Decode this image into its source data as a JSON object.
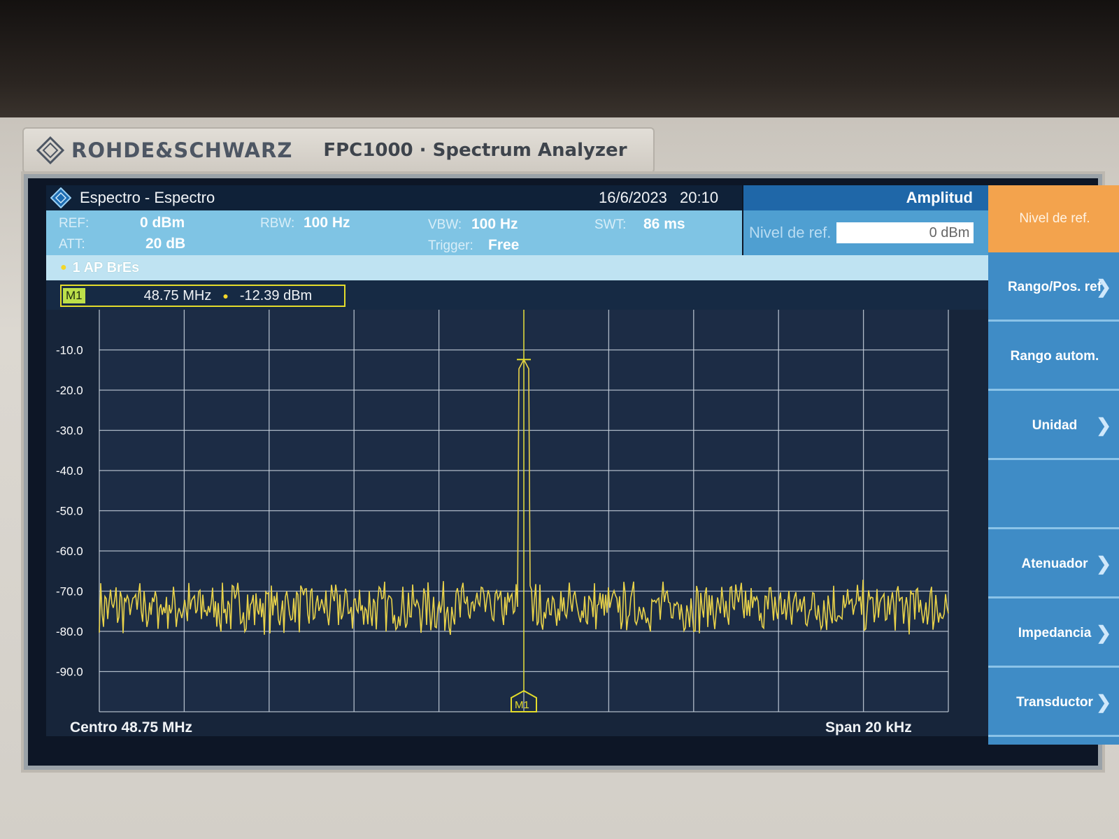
{
  "brand": {
    "name": "ROHDE&SCHWARZ",
    "model": "FPC1000 · Spectrum Analyzer"
  },
  "titlebar": {
    "title": "Espectro - Espectro",
    "date": "16/6/2023",
    "time": "20:10",
    "icon": "rs-diamond-icon"
  },
  "params": {
    "ref_label": "REF:",
    "ref_value": "0 dBm",
    "att_label": "ATT:",
    "att_value": "20 dB",
    "rbw_label": "RBW:",
    "rbw_value": "100 Hz",
    "vbw_label": "VBW:",
    "vbw_value": "100 Hz",
    "trigger_label": "Trigger:",
    "trigger_value": "Free",
    "swt_label": "SWT:",
    "swt_value": "86 ms"
  },
  "panel": {
    "header": "Amplitud",
    "ref_level_label": "Nivel de ref.",
    "ref_level_value": "0 dBm"
  },
  "trace": {
    "label": "1 AP  BrEs",
    "color": "#e8d24a"
  },
  "marker": {
    "name": "M1",
    "frequency": "48.75 MHz",
    "level": "-12.39 dBm"
  },
  "footer": {
    "center": "Centro 48.75 MHz",
    "span": "Span 20 kHz"
  },
  "softkeys": [
    {
      "label": "Nivel de ref.",
      "active": true,
      "chevron": false
    },
    {
      "label": "Rango/Pos. ref",
      "active": false,
      "chevron": true
    },
    {
      "label": "Rango autom.",
      "active": false,
      "chevron": false
    },
    {
      "label": "Unidad",
      "active": false,
      "chevron": true
    },
    {
      "label": "",
      "active": false,
      "chevron": false
    },
    {
      "label": "Atenuador",
      "active": false,
      "chevron": true
    },
    {
      "label": "Impedancia",
      "active": false,
      "chevron": true
    },
    {
      "label": "Transductor",
      "active": false,
      "chevron": true
    }
  ],
  "chevron_glyph": "❯",
  "chart_data": {
    "type": "line",
    "xlabel": "",
    "ylabel": "",
    "x_range": [
      -10,
      10
    ],
    "y_ticks": [
      "-10.0",
      "-20.0",
      "-30.0",
      "-40.0",
      "-50.0",
      "-60.0",
      "-70.0",
      "-80.0",
      "-90.0"
    ],
    "ylim": [
      -100,
      0
    ],
    "grid": true,
    "noise_floor_dbm": -74,
    "series": [
      {
        "peak_x": 0,
        "peak_y": -12.39
      }
    ]
  }
}
